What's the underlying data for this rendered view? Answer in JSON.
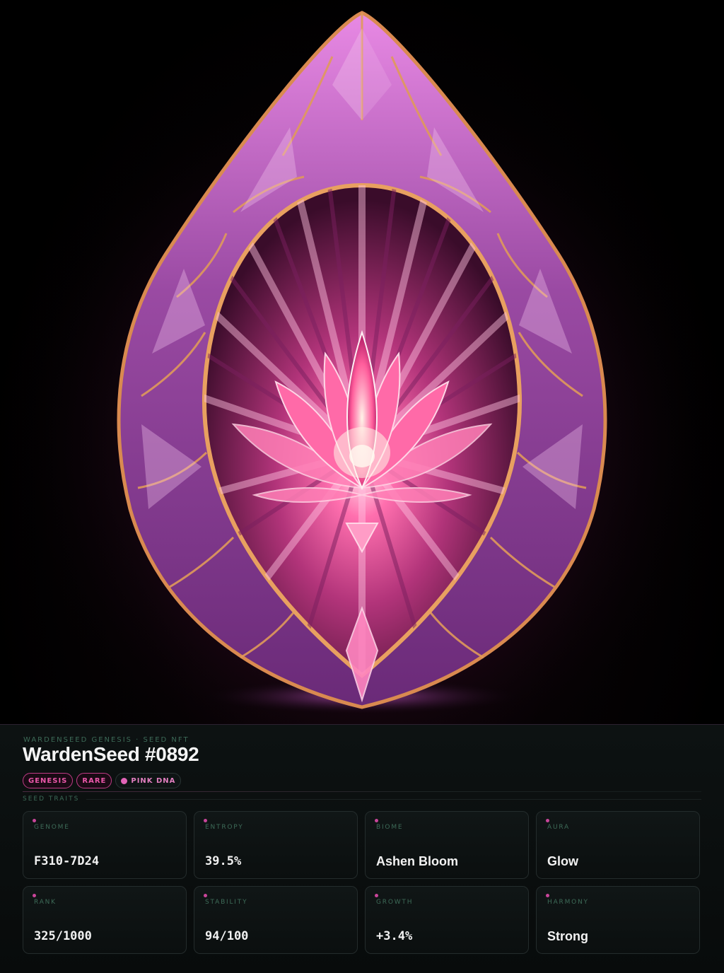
{
  "artwork": {
    "accent_pink": "#ff5fa8",
    "accent_gold": "#d48a4a",
    "accent_violet": "#a44fc4"
  },
  "header": {
    "eyebrow": "WARDENSEED GENESIS · SEED NFT",
    "title": "WardenSeed #0892"
  },
  "chips": [
    {
      "label": "GENESIS"
    },
    {
      "label": "RARE"
    },
    {
      "label": "PINK DNA"
    }
  ],
  "traits_section": {
    "label": "SEED TRAITS"
  },
  "traits": [
    {
      "label": "GENOME",
      "value": "F310-7D24"
    },
    {
      "label": "ENTROPY",
      "value": "39.5%"
    },
    {
      "label": "BIOME",
      "value": "Ashen Bloom"
    },
    {
      "label": "AURA",
      "value": "Glow"
    },
    {
      "label": "RANK",
      "value": "325/1000"
    },
    {
      "label": "STABILITY",
      "value": "94/100"
    },
    {
      "label": "GROWTH",
      "value": "+3.4%"
    },
    {
      "label": "HARMONY",
      "value": "Strong"
    }
  ]
}
